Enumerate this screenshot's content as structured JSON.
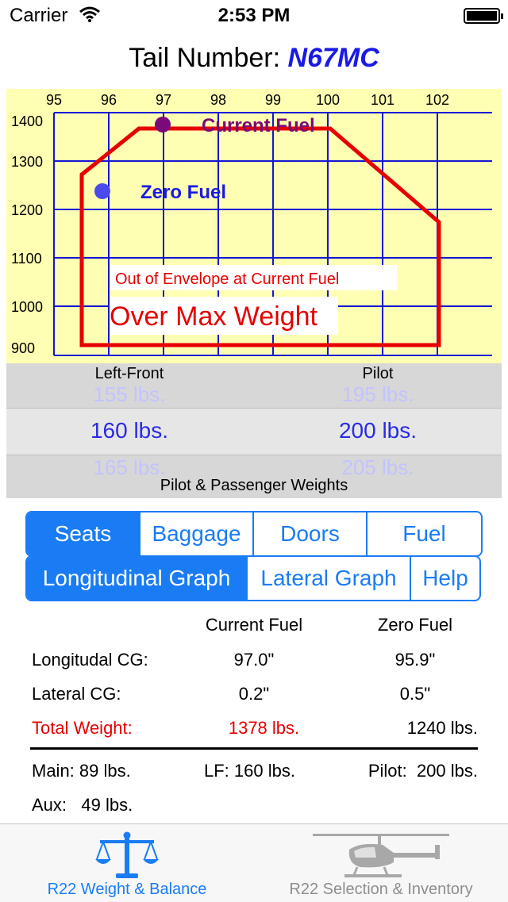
{
  "status": {
    "carrier": "Carrier",
    "time": "2:53 PM"
  },
  "header": {
    "prefix": "Tail Number:",
    "tail": "N67MC"
  },
  "graph": {
    "x_ticks": [
      "95",
      "96",
      "97",
      "98",
      "99",
      "100",
      "101",
      "102"
    ],
    "y_ticks": [
      "1400",
      "1300",
      "1200",
      "1100",
      "1000",
      "900"
    ],
    "current_label": "Current Fuel",
    "zero_label": "Zero Fuel",
    "warn1": "Out of Envelope at Current Fuel",
    "warn2": "Over Max Weight"
  },
  "picker": {
    "left_header": "Left-Front",
    "right_header": "Pilot",
    "left_prev": "155 lbs.",
    "left_value": "160 lbs.",
    "left_next": "165 lbs.",
    "right_prev": "195 lbs.",
    "right_value": "200 lbs.",
    "right_next": "205 lbs.",
    "caption": "Pilot & Passenger Weights"
  },
  "tabs_row1": [
    "Seats",
    "Baggage",
    "Doors",
    "Fuel"
  ],
  "tabs_row2": [
    "Longitudinal Graph",
    "Lateral Graph",
    "Help"
  ],
  "stats": {
    "col_current": "Current Fuel",
    "col_zero": "Zero Fuel",
    "long_label": "Longitudal CG:",
    "long_current": "97.0\"",
    "long_zero": "95.9\"",
    "lat_label": "Lateral CG:",
    "lat_current": "0.2\"",
    "lat_zero": "0.5\"",
    "total_label": "Total Weight:",
    "total_current": "1378 lbs.",
    "total_zero": "1240 lbs.",
    "main": "Main: 89 lbs.",
    "lf": "LF: 160 lbs.",
    "pilot": "Pilot:  200 lbs.",
    "aux": "Aux:   49 lbs."
  },
  "tabbar": {
    "tab1": "R22 Weight & Balance",
    "tab2": "R22 Selection & Inventory"
  },
  "colors": {
    "accent": "#1a7cf4",
    "warning": "#e60000",
    "graph_bg": "#ffffb3",
    "grid": "#1515d6"
  }
}
